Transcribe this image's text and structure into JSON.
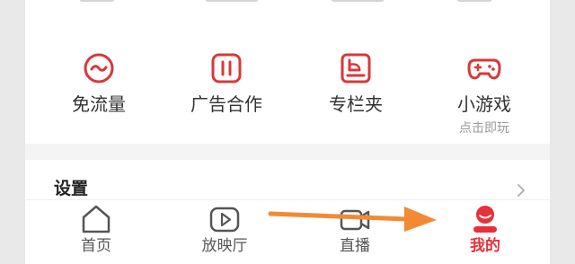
{
  "colors": {
    "accent_red": "#e8303a",
    "tool_icon_red": "#d8383a",
    "tab_icon_gray": "#555555",
    "annotation_orange": "#f28a35"
  },
  "tools": [
    {
      "label": "免流量",
      "icon": "smile-circle-icon"
    },
    {
      "label": "广告合作",
      "icon": "pause-square-icon"
    },
    {
      "label": "专栏夹",
      "icon": "column-folder-icon"
    },
    {
      "label": "小游戏",
      "sublabel": "点击即玩",
      "icon": "gamepad-icon"
    }
  ],
  "settings": {
    "title": "设置"
  },
  "tabbar": {
    "items": [
      {
        "label": "首页",
        "icon": "home-icon"
      },
      {
        "label": "放映厅",
        "icon": "play-icon"
      },
      {
        "label": "直播",
        "icon": "camera-icon"
      },
      {
        "label": "我的",
        "icon": "profile-icon",
        "active": true
      }
    ]
  },
  "annotation": {
    "type": "arrow",
    "points_to": "我的"
  }
}
